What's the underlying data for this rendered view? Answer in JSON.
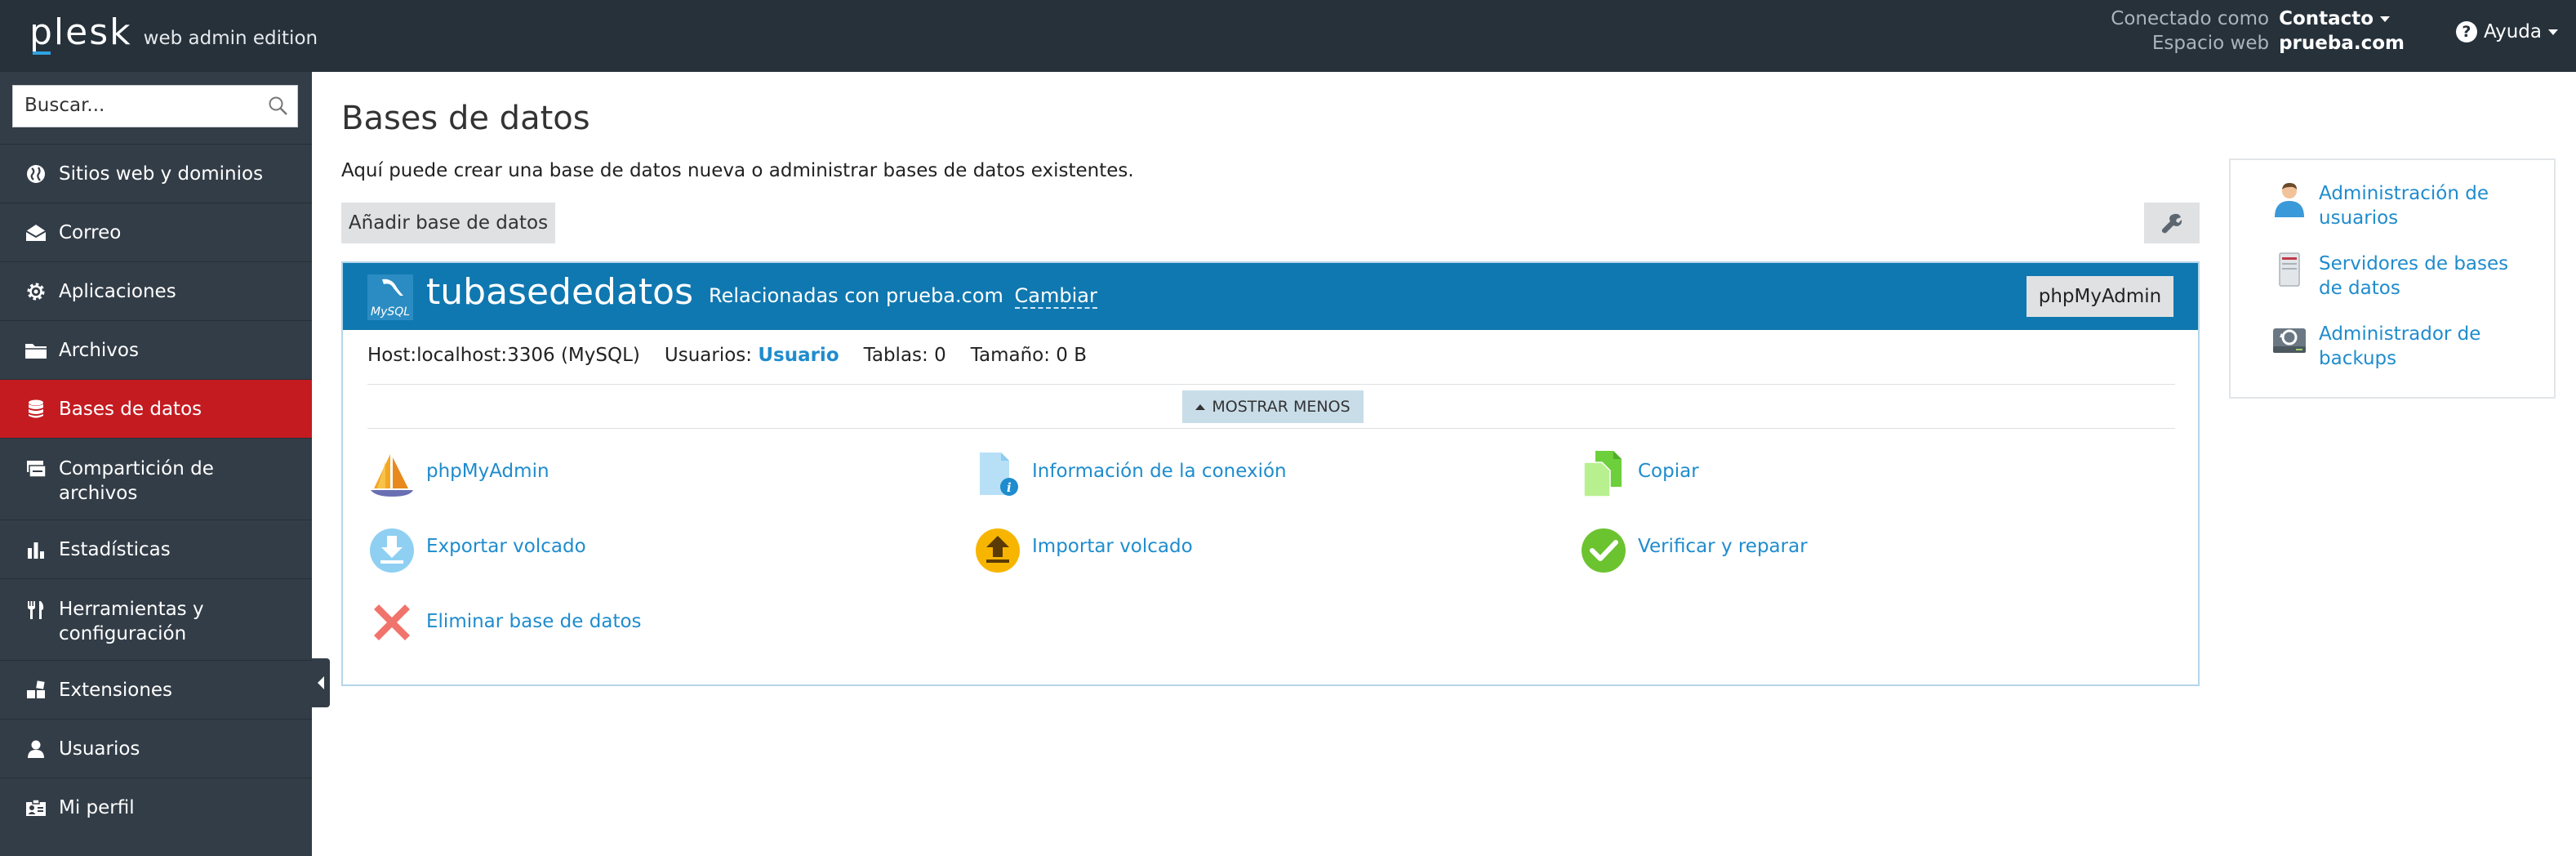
{
  "header": {
    "logo": "plesk",
    "edition": "web admin edition",
    "connected_label": "Conectado como",
    "connected_value": "Contacto",
    "webspace_label": "Espacio web",
    "webspace_value": "prueba.com",
    "help_label": "Ayuda"
  },
  "sidebar": {
    "search_placeholder": "Buscar...",
    "items": [
      {
        "label": "Sitios web y dominios",
        "icon": "globe-icon"
      },
      {
        "label": "Correo",
        "icon": "envelope-icon"
      },
      {
        "label": "Aplicaciones",
        "icon": "gear-icon"
      },
      {
        "label": "Archivos",
        "icon": "folder-icon"
      },
      {
        "label": "Bases de datos",
        "icon": "database-icon",
        "active": true
      },
      {
        "label": "Compartición de archivos",
        "icon": "file-sharing-icon"
      },
      {
        "label": "Estadísticas",
        "icon": "bar-chart-icon"
      },
      {
        "label": "Herramientas y configuración",
        "icon": "tools-icon"
      },
      {
        "label": "Extensiones",
        "icon": "extensions-icon"
      },
      {
        "label": "Usuarios",
        "icon": "user-icon"
      },
      {
        "label": "Mi perfil",
        "icon": "profile-card-icon"
      }
    ]
  },
  "main": {
    "title": "Bases de datos",
    "intro": "Aquí puede crear una base de datos nueva o administrar bases de datos existentes.",
    "add_button": "Añadir base de datos",
    "database": {
      "logo_text": "MySQL",
      "name": "tubasededatos",
      "related_text": "Relacionadas con prueba.com",
      "change_link": "Cambiar",
      "phpmyadmin_button": "phpMyAdmin",
      "host": "Host:localhost:3306 (MySQL)",
      "users_label": "Usuarios:",
      "users_value": "Usuario",
      "tables": "Tablas: 0",
      "size": "Tamaño: 0 B",
      "show_less": "MOSTRAR MENOS",
      "actions": {
        "phpmyadmin": "phpMyAdmin",
        "connection_info": "Información de la conexión",
        "copy": "Copiar",
        "export_dump": "Exportar volcado",
        "import_dump": "Importar volcado",
        "check_repair": "Verificar y reparar",
        "delete_db": "Eliminar base de datos"
      }
    }
  },
  "side_panel": {
    "user_admin": "Administración de usuarios",
    "db_servers": "Servidores de bases de datos",
    "backup_manager": "Administrador de backups"
  },
  "colors": {
    "topbar": "#26313a",
    "sidebar": "#333d47",
    "active": "#c41b21",
    "db_header": "#1078b0",
    "link": "#1f8ccd"
  }
}
